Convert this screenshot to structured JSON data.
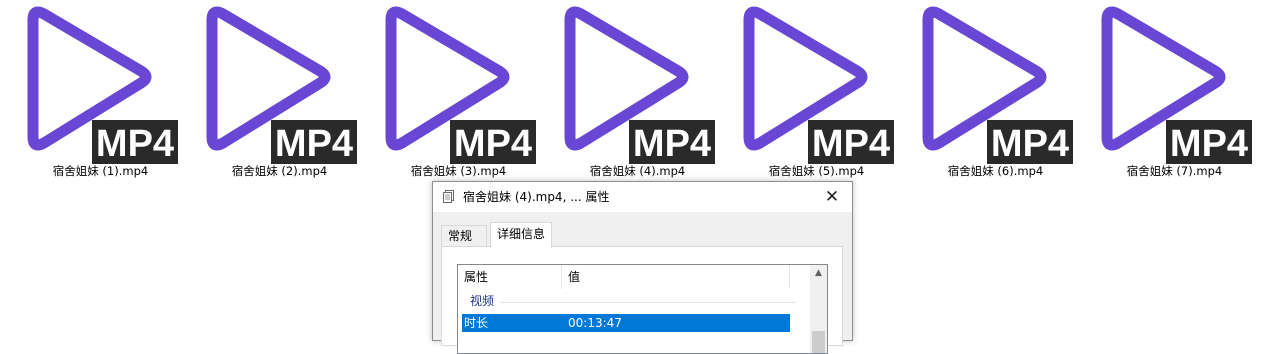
{
  "files": [
    {
      "name": "宿舍姐妹 (1).mp4",
      "badge": "MP4"
    },
    {
      "name": "宿舍姐妹 (2).mp4",
      "badge": "MP4"
    },
    {
      "name": "宿舍姐妹 (3).mp4",
      "badge": "MP4"
    },
    {
      "name": "宿舍姐妹 (4).mp4",
      "badge": "MP4"
    },
    {
      "name": "宿舍姐妹 (5).mp4",
      "badge": "MP4"
    },
    {
      "name": "宿舍姐妹 (6).mp4",
      "badge": "MP4"
    },
    {
      "name": "宿舍姐妹 (7).mp4",
      "badge": "MP4"
    }
  ],
  "icon": {
    "play_color": "#6a46d4",
    "badge_bg": "#2a2a2a",
    "badge_fg": "#ffffff"
  },
  "dialog": {
    "title": "宿舍姐妹 (4).mp4, ... 属性",
    "close_glyph": "✕",
    "tabs": [
      {
        "label": "常规",
        "active": false
      },
      {
        "label": "详细信息",
        "active": true
      }
    ],
    "columns": [
      "属性",
      "值"
    ],
    "group": "视频",
    "rows": [
      {
        "key": "时长",
        "value": "00:13:47",
        "selected": true
      }
    ],
    "selection_color": "#0078d7"
  }
}
